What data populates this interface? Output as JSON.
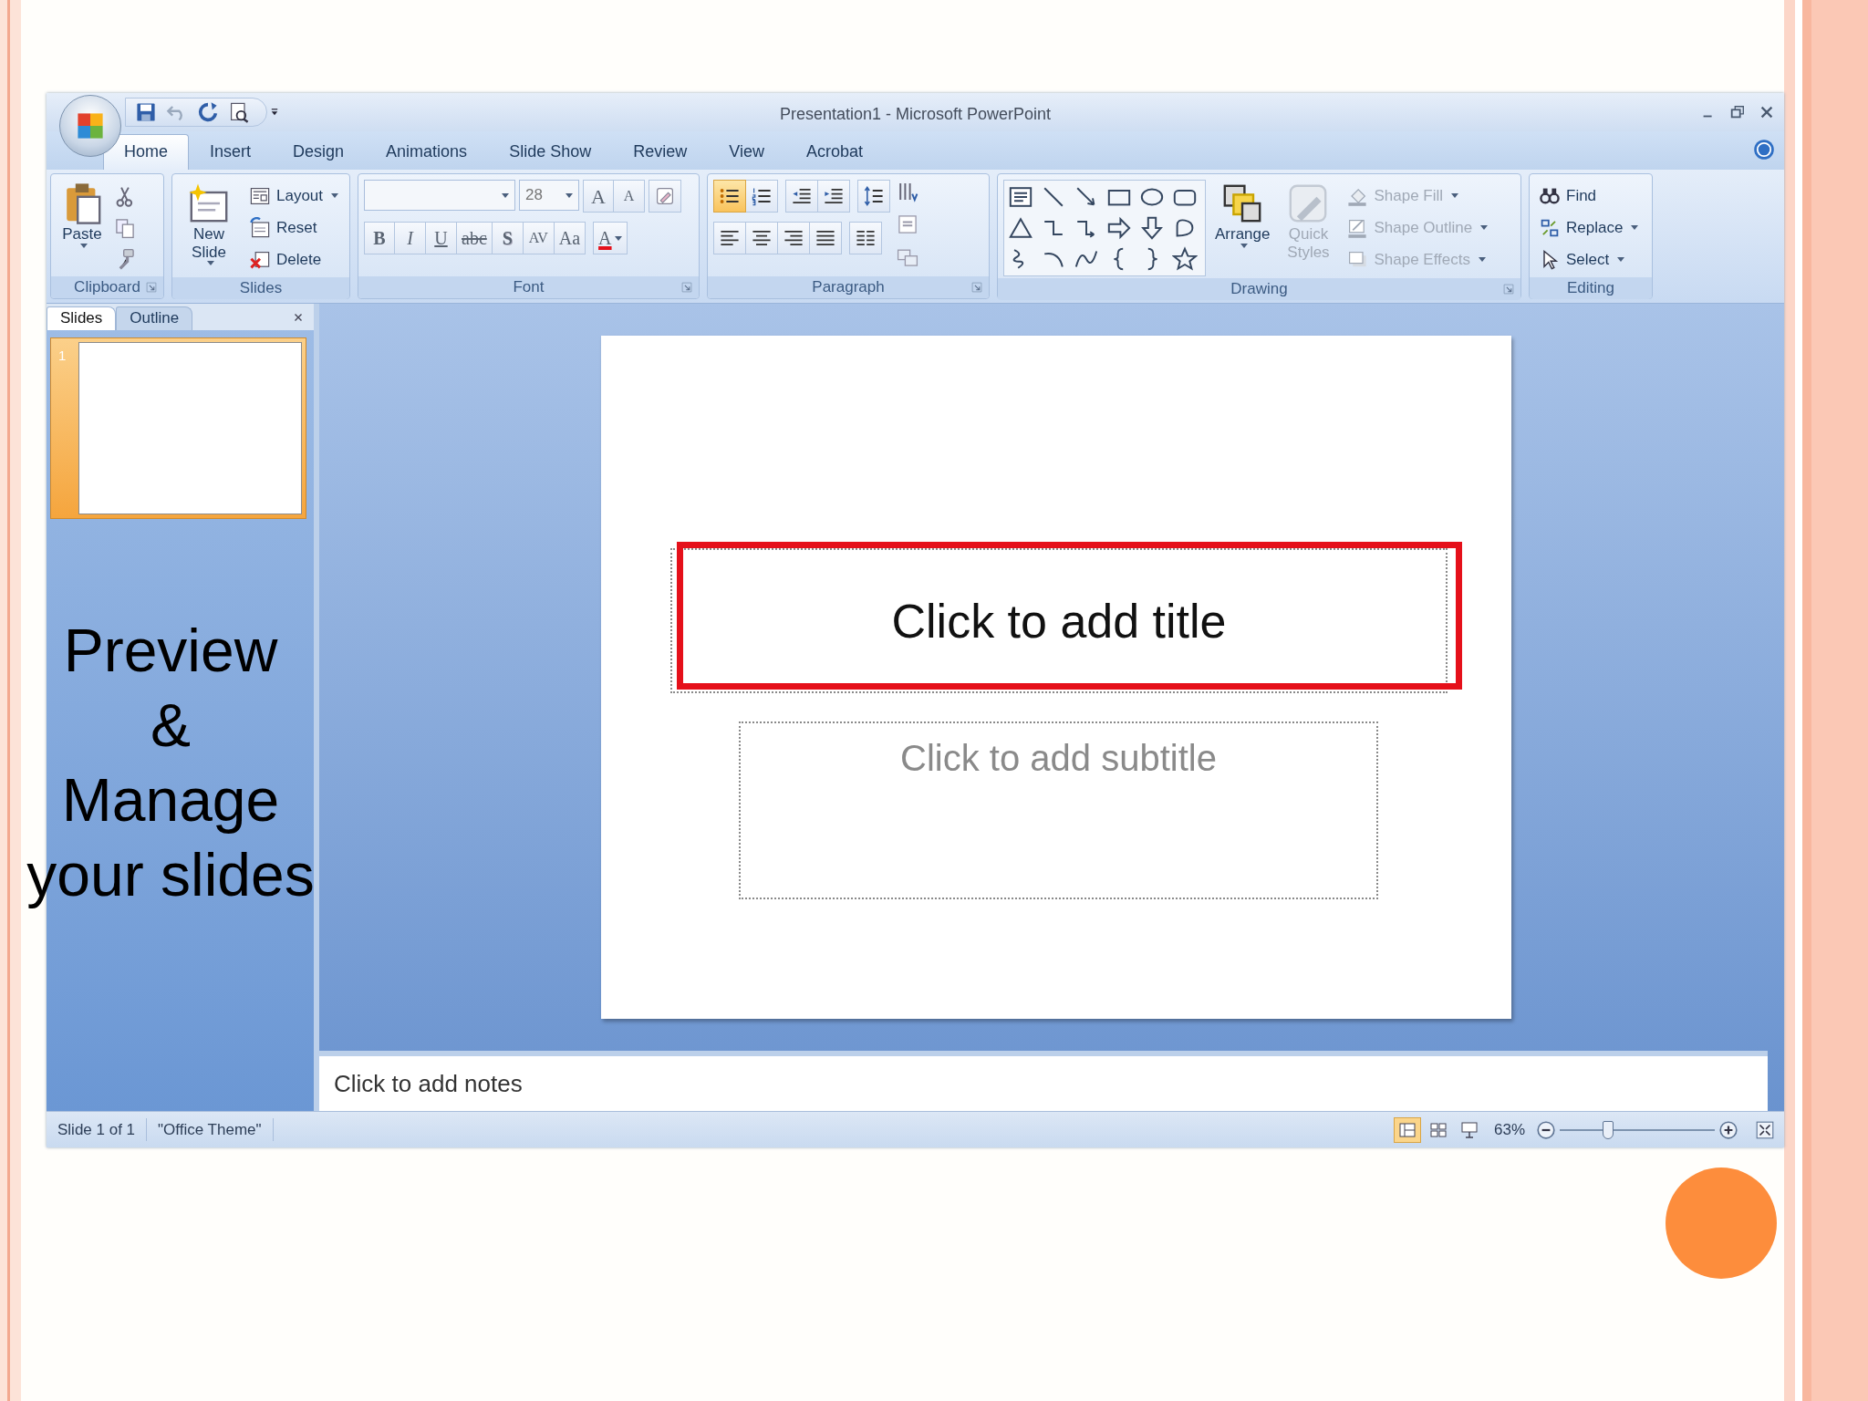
{
  "window": {
    "title": "Presentation1 - Microsoft PowerPoint"
  },
  "tabs": [
    {
      "label": "Home",
      "selected": true
    },
    {
      "label": "Insert",
      "selected": false
    },
    {
      "label": "Design",
      "selected": false
    },
    {
      "label": "Animations",
      "selected": false
    },
    {
      "label": "Slide Show",
      "selected": false
    },
    {
      "label": "Review",
      "selected": false
    },
    {
      "label": "View",
      "selected": false
    },
    {
      "label": "Acrobat",
      "selected": false
    }
  ],
  "ribbon": {
    "groups": [
      {
        "kind": "clipboard",
        "label": "Clipboard",
        "launcher": true,
        "paste": "Paste"
      },
      {
        "kind": "slides",
        "label": "Slides",
        "launcher": false,
        "new_slide": "New Slide",
        "commands": [
          {
            "label": "Layout",
            "dropdown": true
          },
          {
            "label": "Reset",
            "dropdown": false
          },
          {
            "label": "Delete",
            "dropdown": false
          }
        ]
      },
      {
        "kind": "font",
        "label": "Font",
        "launcher": true,
        "font_size": "28",
        "size_buttons": [
          {
            "label": "A",
            "kind": "grow"
          },
          {
            "label": "A",
            "kind": "shrink"
          }
        ],
        "format_buttons": [
          {
            "label": "B",
            "kind": "bold"
          },
          {
            "label": "I",
            "kind": "italic"
          },
          {
            "label": "U",
            "kind": "underline"
          },
          {
            "label": "abc",
            "kind": "strike"
          },
          {
            "label": "S",
            "kind": "shadow"
          },
          {
            "label": "AV",
            "kind": "spacing"
          },
          {
            "label": "Aa",
            "kind": "case"
          },
          {
            "label": "A",
            "kind": "color"
          }
        ]
      },
      {
        "kind": "paragraph",
        "label": "Paragraph",
        "launcher": true,
        "bullets_on": true
      },
      {
        "kind": "drawing",
        "label": "Drawing",
        "launcher": true,
        "arrange": "Arrange",
        "quick_styles": {
          "label": "Quick Styles",
          "disabled": true
        },
        "commands": [
          {
            "label": "Shape Fill",
            "disabled": true
          },
          {
            "label": "Shape Outline",
            "disabled": true
          },
          {
            "label": "Shape Effects",
            "disabled": true
          }
        ]
      },
      {
        "kind": "editing",
        "label": "Editing",
        "launcher": false,
        "commands": [
          {
            "label": "Find",
            "dropdown": false
          },
          {
            "label": "Replace",
            "dropdown": true
          },
          {
            "label": "Select",
            "dropdown": true
          }
        ]
      }
    ]
  },
  "pane": {
    "tabs": [
      {
        "label": "Slides",
        "selected": true
      },
      {
        "label": "Outline",
        "selected": false
      }
    ],
    "slides": [
      {
        "number": "1",
        "selected": true
      }
    ]
  },
  "slide": {
    "title_placeholder": "Click to add title",
    "subtitle_placeholder": "Click to add subtitle"
  },
  "notes": {
    "text": "Click to add notes"
  },
  "status_bar": {
    "slide_info": "Slide 1 of 1",
    "theme": "\"Office Theme\"",
    "views": [
      {
        "selected": true
      },
      {
        "selected": false
      },
      {
        "selected": false
      }
    ],
    "zoom": "63%",
    "zoom_slider": {
      "level": 0.31
    }
  },
  "callout": {
    "lines": [
      "Preview",
      "&",
      "Manage",
      "your slides"
    ]
  }
}
